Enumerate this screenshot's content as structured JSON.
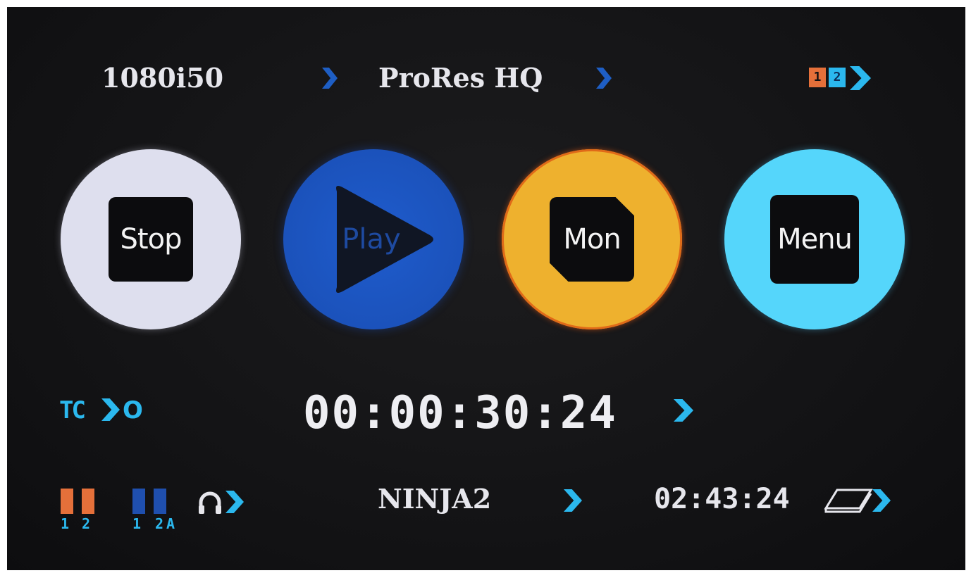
{
  "status_bar": {
    "video_format": "1080i50",
    "codec": "ProRes HQ",
    "source_1_label": "1",
    "source_2_label": "2"
  },
  "buttons": {
    "stop_label": "Stop",
    "play_label": "Play",
    "monitor_label": "Mon",
    "menu_label": "Menu"
  },
  "timecode": {
    "source_label": "TC",
    "source_value": "O",
    "value": "00:00:30:24"
  },
  "audio": {
    "input_labels": [
      "1",
      "2"
    ],
    "output_labels": [
      "1",
      "2A"
    ]
  },
  "footer": {
    "device_name": "NINJA2",
    "remaining_time": "02:43:24"
  },
  "colors": {
    "accent_blue": "#2bb8ee",
    "dark_blue": "#1f4fae",
    "orange": "#e5703a",
    "stop_ring": "#dedfee",
    "play_ring": "#1b55c4",
    "mon_ring": "#eeb12e",
    "menu_ring": "#55d6fb"
  },
  "icons": [
    "chevron-right-icon",
    "headphones-icon",
    "disk-icon",
    "play-triangle-icon"
  ]
}
